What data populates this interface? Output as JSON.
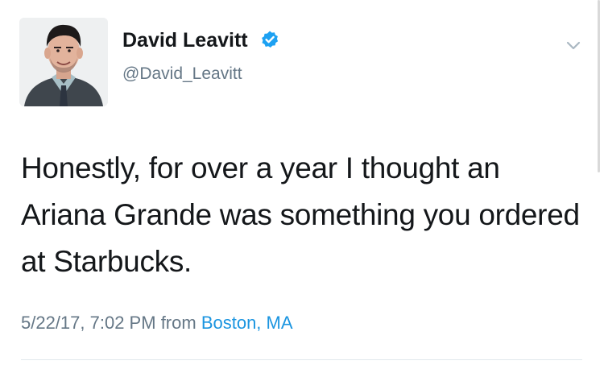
{
  "tweet": {
    "author": {
      "display_name": "David Leavitt",
      "handle": "@David_Leavitt",
      "verified": true,
      "verified_icon": "verified-badge-icon"
    },
    "text": "Honestly, for over a year I thought an Ariana Grande was something you ordered at Starbucks.",
    "timestamp": "5/22/17, 7:02 PM",
    "source_prefix": "from",
    "location": "Boston, MA",
    "menu_icon": "chevron-down-icon"
  },
  "colors": {
    "primary_text": "#14171a",
    "secondary_text": "#657786",
    "link": "#1b95e0",
    "verified_badge": "#1da1f2",
    "divider": "#e1e8ed"
  }
}
